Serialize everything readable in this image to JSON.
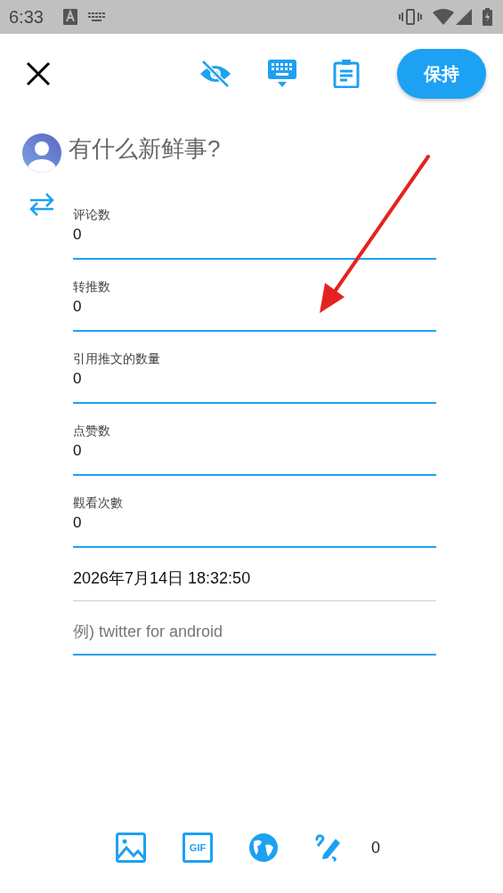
{
  "status_bar": {
    "time": "6:33"
  },
  "toolbar": {
    "save_button": "保持"
  },
  "compose": {
    "placeholder": "有什么新鲜事?"
  },
  "fields": [
    {
      "kind": "number",
      "label": "评论数",
      "value": "0"
    },
    {
      "kind": "number",
      "label": "转推数",
      "value": "0"
    },
    {
      "kind": "number",
      "label": "引用推文的数量",
      "value": "0"
    },
    {
      "kind": "number",
      "label": "点赞数",
      "value": "0"
    },
    {
      "kind": "number",
      "label": "觀看次數",
      "value": "0"
    },
    {
      "kind": "date",
      "value": "2026年7月14日 18:32:50"
    },
    {
      "kind": "source",
      "placeholder": "例) twitter for android"
    }
  ],
  "bottom_bar": {
    "gif_label": "GIF",
    "count": "0"
  }
}
